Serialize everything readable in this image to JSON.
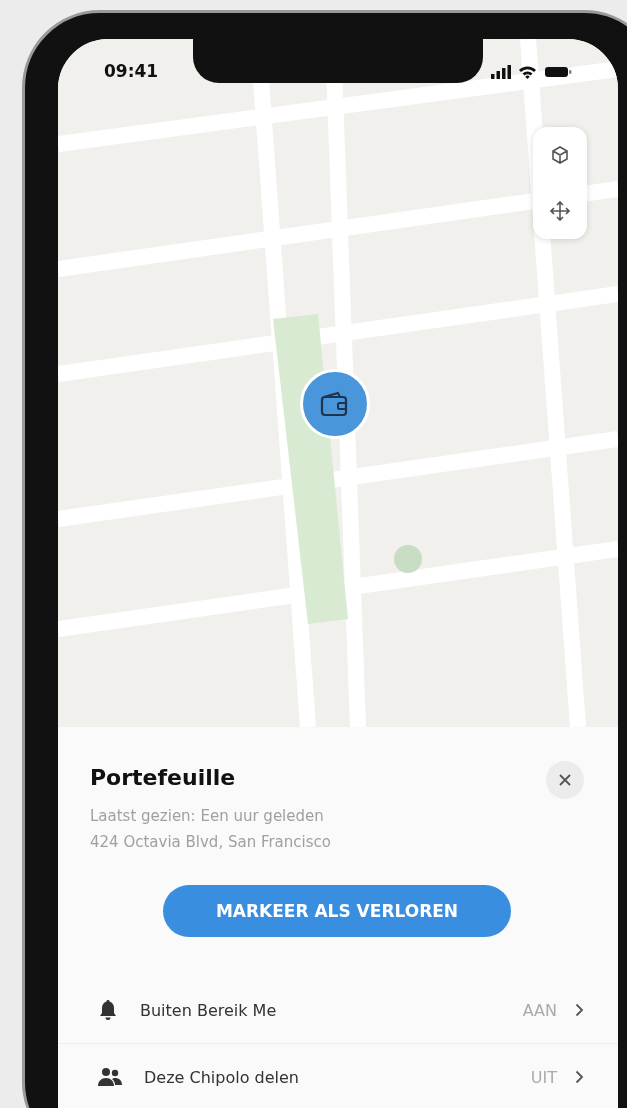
{
  "status_bar": {
    "time": "09:41"
  },
  "item": {
    "name": "Portefeuille",
    "last_seen": "Laatst gezien: Een uur geleden",
    "address": "424 Octavia Blvd, San Francisco"
  },
  "primary_button": "MARKEER ALS VERLOREN",
  "settings": [
    {
      "kind": "bell",
      "label": "Buiten Bereik Me",
      "value": "AAN"
    },
    {
      "kind": "people",
      "label": "Deze Chipolo delen",
      "value": "UIT"
    }
  ]
}
